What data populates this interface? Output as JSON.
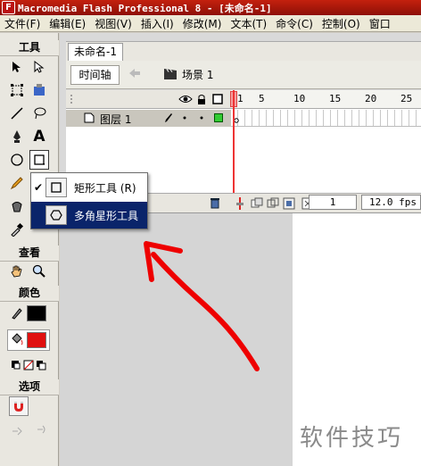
{
  "window": {
    "title": "Macromedia Flash Professional 8 - [未命名-1]",
    "app_icon_letter": "F"
  },
  "menu": [
    "文件(F)",
    "编辑(E)",
    "视图(V)",
    "插入(I)",
    "修改(M)",
    "文本(T)",
    "命令(C)",
    "控制(O)",
    "窗口"
  ],
  "tools_panel": {
    "title": "工具",
    "view_title": "查看",
    "color_title": "颜色",
    "options_title": "选项",
    "icons": [
      "selection-icon",
      "subselection-icon",
      "free-transform-icon",
      "gradient-transform-icon",
      "line-icon",
      "lasso-icon",
      "pen-icon",
      "text-icon",
      "oval-icon",
      "rectangle-icon",
      "pencil-icon",
      "brush-icon",
      "ink-bottle-icon",
      "paint-bucket-icon",
      "eyedropper-icon",
      "eraser-icon",
      "hand-icon",
      "zoom-icon",
      "stroke-color-icon",
      "fill-color-icon",
      "snap-magnet-icon"
    ],
    "text_tool_glyph": "A",
    "colors": {
      "stroke": "#000000",
      "fill": "#e01010"
    }
  },
  "document": {
    "tab_label": "未命名-1",
    "timeline_button": "时间轴",
    "scene_label": "场景 1"
  },
  "timeline": {
    "frame_numbers": [
      "1",
      "5",
      "10",
      "15",
      "20",
      "25"
    ],
    "layer_name": "图层 1",
    "current_frame": "1",
    "fps": "12.0 fps"
  },
  "flyout_menu": {
    "items": [
      {
        "label": "矩形工具 (R)",
        "checked": true,
        "check_glyph": "✔"
      },
      {
        "label": "多角星形工具",
        "checked": false,
        "selected": true
      }
    ]
  },
  "watermark": "软件技巧"
}
